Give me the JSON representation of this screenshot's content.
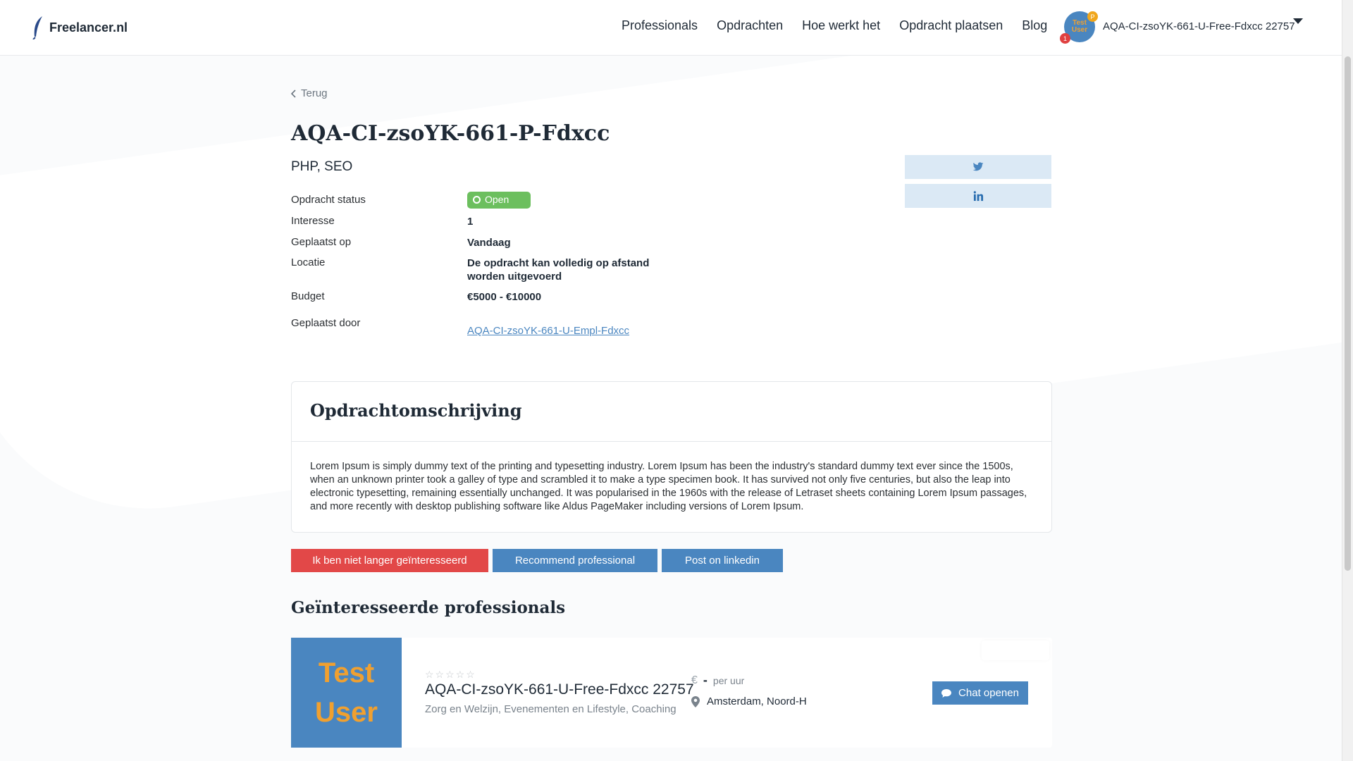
{
  "header": {
    "logo_text": "Freelancer.nl",
    "nav": [
      "Professionals",
      "Opdrachten",
      "Hoe werkt het",
      "Opdracht plaatsen",
      "Blog"
    ],
    "avatar_text": "Test User",
    "badge_orange": "P",
    "badge_red": "1",
    "user_name": "AQA-CI-zsoYK-661-U-Free-Fdxcc 22757"
  },
  "page": {
    "back_label": "Terug",
    "title": "AQA-CI-zsoYK-661-P-Fdxcc",
    "skills": "PHP, SEO",
    "info": {
      "status_label": "Opdracht status",
      "status_value": "Open",
      "interest_label": "Interesse",
      "interest_value": "1",
      "posted_label": "Geplaatst op",
      "posted_value": "Vandaag",
      "location_label": "Locatie",
      "location_value": "De opdracht kan volledig op afstand worden uitgevoerd",
      "budget_label": "Budget",
      "budget_value": "€5000 - €10000",
      "posted_by_label": "Geplaatst door",
      "posted_by_value": "AQA-CI-zsoYK-661-U-Empl-Fdxcc"
    },
    "description": {
      "heading": "Opdrachtomschrijving",
      "text": "Lorem Ipsum is simply dummy text of the printing and typesetting industry. Lorem Ipsum has been the industry's standard dummy text ever since the 1500s, when an unknown printer took a galley of type and scrambled it to make a type specimen book. It has survived not only five centuries, but also the leap into electronic typesetting, remaining essentially unchanged. It was popularised in the 1960s with the release of Letraset sheets containing Lorem Ipsum passages, and more recently with desktop publishing software like Aldus PageMaker including versions of Lorem Ipsum."
    },
    "buttons": {
      "not_interested": "Ik ben niet langer geïnteresseerd",
      "recommend": "Recommend professional",
      "linkedin": "Post on linkedin"
    },
    "interested_heading": "Geïnteresseerde professionals",
    "professional": {
      "photo_text": "Test User",
      "stars": "☆☆☆☆☆",
      "name": "AQA-CI-zsoYK-661-U-Free-Fdxcc 22757",
      "tags": "Zorg en Welzijn, Evenementen en Lifestyle, Coaching",
      "currency": "€",
      "rate": "-",
      "rate_unit": "per uur",
      "location": "Amsterdam, Noord-H",
      "chat_label": "Chat openen"
    }
  },
  "colors": {
    "primary": "#4a86c0",
    "danger": "#e24848",
    "success": "#6cbf5e",
    "share_bg": "#dbe9f5"
  },
  "icons": [
    "feather-logo-icon",
    "chevron-left-icon",
    "twitter-icon",
    "linkedin-icon",
    "star-icon",
    "euro-icon",
    "map-pin-icon",
    "chat-bubble-icon",
    "caret-down-icon"
  ]
}
